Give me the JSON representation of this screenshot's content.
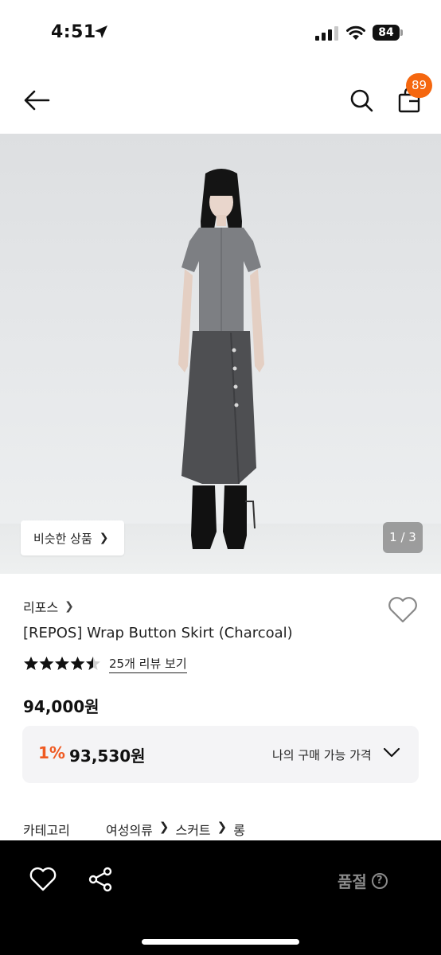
{
  "status_bar": {
    "time": "4:51",
    "battery": "84"
  },
  "nav": {
    "cart_count": "89"
  },
  "hero": {
    "similar_button": "비슷한 상품",
    "page_indicator": "1 / 3"
  },
  "product": {
    "brand": "리포스",
    "name": "[REPOS] Wrap Button Skirt (Charcoal)",
    "rating": 4.5,
    "review_link": "25개 리뷰 보기",
    "price": "94,000원",
    "my_price": {
      "discount": "1%",
      "amount": "93,530원",
      "label": "나의 구매 가능 가격"
    },
    "category": {
      "label": "카테고리",
      "path": [
        "여성의류",
        "스커트",
        "롱"
      ]
    }
  },
  "bottom_bar": {
    "status": "품절"
  },
  "colors": {
    "accent": "#f5670f",
    "discount": "#ef5a22",
    "bar": "#000000"
  }
}
